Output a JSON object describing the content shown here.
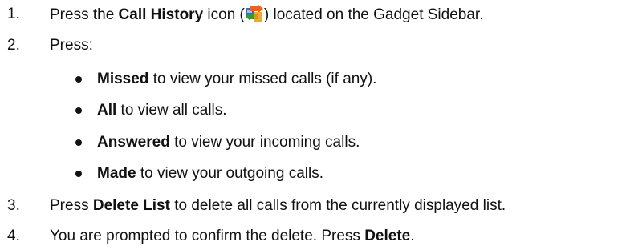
{
  "steps": [
    {
      "number": "1.",
      "pre": "Press the ",
      "bold": "Call History",
      "mid": " icon (",
      "icon": "call-history-icon",
      "post": ") located on the Gadget Sidebar."
    },
    {
      "number": "2.",
      "text": "Press:",
      "bullets": [
        {
          "bold": "Missed",
          "text": " to view your missed calls (if any)."
        },
        {
          "bold": "All",
          "text": " to view all calls."
        },
        {
          "bold": "Answered",
          "text": " to view your incoming calls."
        },
        {
          "bold": "Made",
          "text": " to view your outgoing calls."
        }
      ]
    },
    {
      "number": "3.",
      "pre": "Press ",
      "bold": "Delete List",
      "post": " to delete all calls from the currently displayed list."
    },
    {
      "number": "4.",
      "pre": "You are prompted to confirm the delete. Press ",
      "bold": "Delete",
      "post": "."
    }
  ],
  "colors": {
    "text": "#111111",
    "icon_green": "#3a9a2a",
    "icon_orange": "#e8641c",
    "icon_blue": "#3a6fb8"
  }
}
